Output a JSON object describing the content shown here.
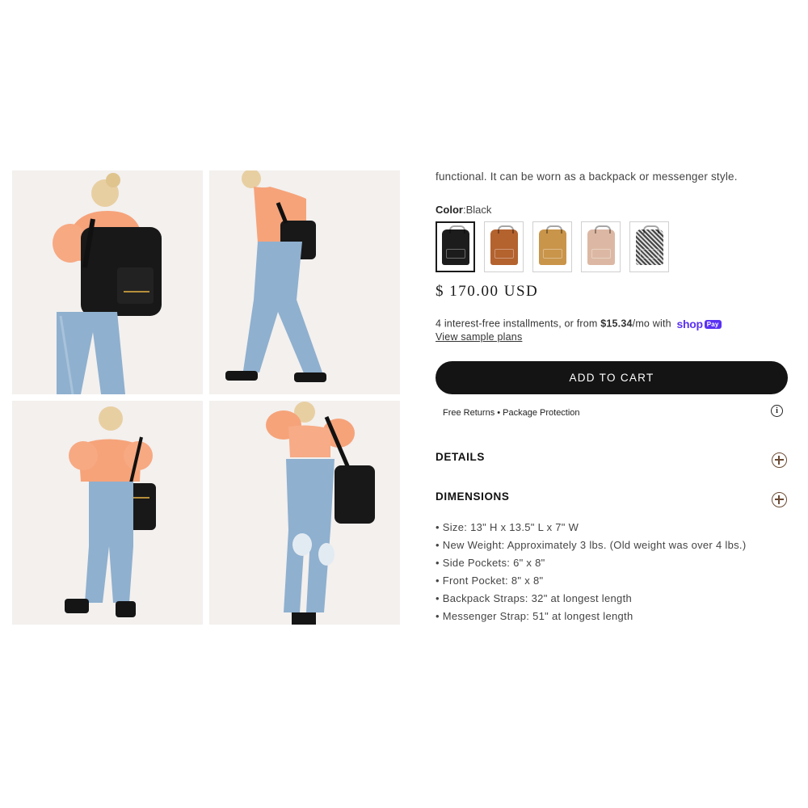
{
  "gallery": {
    "images": [
      {
        "alt": "model-back-backpack"
      },
      {
        "alt": "model-walking-side"
      },
      {
        "alt": "model-front-messenger"
      },
      {
        "alt": "model-front-crossbody"
      }
    ]
  },
  "product": {
    "description": "functional. It can be worn as a backpack or messenger style.",
    "color_label": "Color",
    "color_value": "Black",
    "swatches": [
      {
        "name": "Black",
        "color": "#1c1c1c",
        "selected": true
      },
      {
        "name": "Brown",
        "color": "#b4622e",
        "selected": false
      },
      {
        "name": "Tan",
        "color": "#c9954a",
        "selected": false
      },
      {
        "name": "Blush",
        "color": "#dcb8a4",
        "selected": false
      },
      {
        "name": "Houndstooth",
        "color": "#6e6e6e",
        "selected": false
      }
    ],
    "price": "$ 170.00 USD",
    "installments_prefix": "4 interest-free installments, or from ",
    "installments_amount": "$15.34",
    "installments_suffix": "/mo with",
    "shoppay_brand": "shop",
    "shoppay_badge": "Pay",
    "sample_plans_link": "View sample plans",
    "add_to_cart": "ADD TO CART",
    "returns_text": "Free Returns • Package Protection",
    "info_icon_glyph": "i"
  },
  "accordion": {
    "details_title": "DETAILS",
    "dimensions_title": "DIMENSIONS",
    "dimensions_items": [
      "Size: 13\" H x 13.5\" L x 7\" W",
      "New Weight: Approximately 3 lbs. (Old weight was over 4 lbs.)",
      "Side Pockets: 6\" x 8\"",
      "Front Pocket: 8\" x 8\"",
      "Backpack Straps: 32\" at longest length",
      "Messenger Strap: 51\" at longest length"
    ]
  },
  "colors": {
    "accent": "#5a31f4",
    "button": "#141414",
    "accordion_icon": "#6b4a33"
  }
}
